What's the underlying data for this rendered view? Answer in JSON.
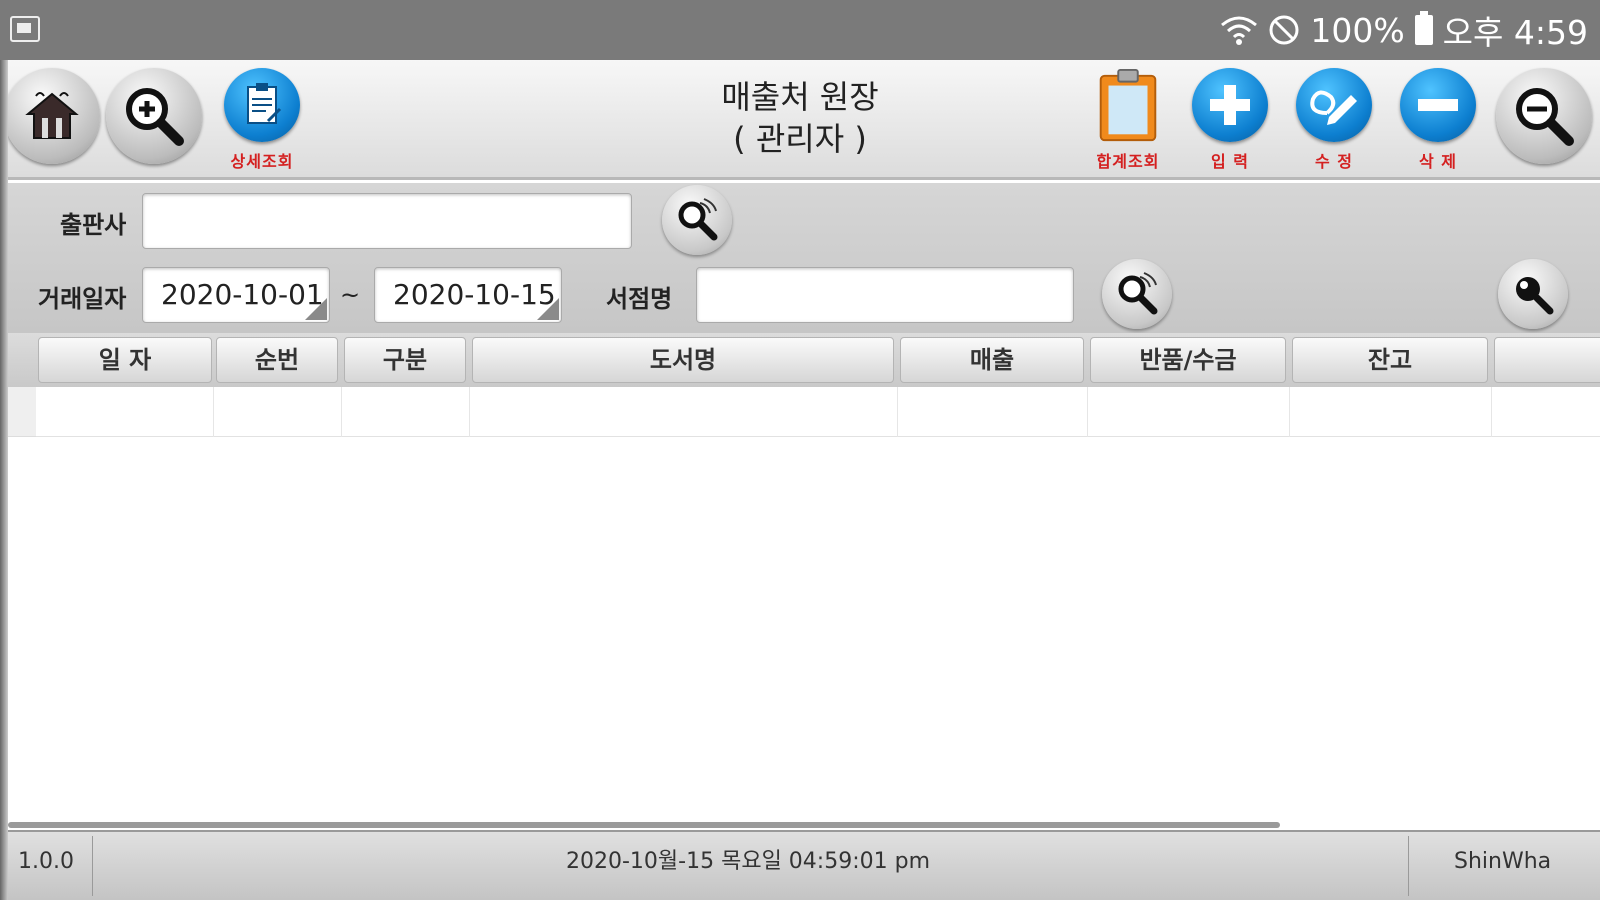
{
  "status_bar": {
    "battery": "100%",
    "time": "오후 4:59"
  },
  "toolbar": {
    "detail_label": "상세조회",
    "title_line1": "매출처 원장",
    "title_line2": "( 관리자 )",
    "sum_label": "합계조회",
    "input_label": "입 력",
    "edit_label": "수 정",
    "delete_label": "삭 제"
  },
  "filters": {
    "publisher_label": "출판사",
    "publisher_value": "",
    "date_label": "거래일자",
    "date_from": "2020-10-01",
    "date_sep": "~",
    "date_to": "2020-10-15",
    "store_label": "서점명",
    "store_value": ""
  },
  "table": {
    "columns": [
      "일 자",
      "순번",
      "구분",
      "도서명",
      "매출",
      "반품/수금",
      "잔고",
      ""
    ],
    "rows": []
  },
  "footer": {
    "version": "1.0.0",
    "datetime": "2020-10월-15 목요일 04:59:01 pm",
    "company": "ShinWha"
  },
  "colors": {
    "label_red": "#d42020",
    "button_blue": "#0d7fd0",
    "clipboard_orange": "#f08a1c"
  }
}
